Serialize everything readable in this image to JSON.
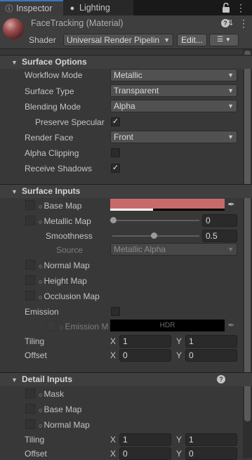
{
  "tabs": {
    "inspector": "Inspector",
    "lighting": "Lighting",
    "inspector_icon": "info-icon",
    "lighting_icon": "lightbulb-icon"
  },
  "material": {
    "name": "FaceTracking (Material)",
    "shader_label": "Shader",
    "shader_value": "Universal Render Pipelin",
    "edit_button": "Edit...",
    "list_icon": "list-icon"
  },
  "surface_options": {
    "title": "Surface Options",
    "workflow_mode": {
      "label": "Workflow Mode",
      "value": "Metallic"
    },
    "surface_type": {
      "label": "Surface Type",
      "value": "Transparent"
    },
    "blending_mode": {
      "label": "Blending Mode",
      "value": "Alpha"
    },
    "preserve_specular": {
      "label": "Preserve Specular",
      "checked": true
    },
    "render_face": {
      "label": "Render Face",
      "value": "Front"
    },
    "alpha_clipping": {
      "label": "Alpha Clipping",
      "checked": false
    },
    "receive_shadows": {
      "label": "Receive Shadows",
      "checked": true
    }
  },
  "surface_inputs": {
    "title": "Surface Inputs",
    "base_map": {
      "label": "Base Map",
      "color": "#c96a6a"
    },
    "metallic_map": {
      "label": "Metallic Map",
      "value": "0",
      "slider": 0
    },
    "smoothness": {
      "label": "Smoothness",
      "value": "0.5",
      "slider": 0.5
    },
    "source": {
      "label": "Source",
      "value": "Metallic Alpha"
    },
    "normal_map": {
      "label": "Normal Map"
    },
    "height_map": {
      "label": "Height Map"
    },
    "occlusion_map": {
      "label": "Occlusion Map"
    },
    "emission": {
      "label": "Emission",
      "checked": false
    },
    "emission_map": {
      "label": "Emission M",
      "hdr": "HDR"
    },
    "tiling": {
      "label": "Tiling",
      "x_axis": "X",
      "x": "1",
      "y_axis": "Y",
      "y": "1"
    },
    "offset": {
      "label": "Offset",
      "x_axis": "X",
      "x": "0",
      "y_axis": "Y",
      "y": "0"
    }
  },
  "detail_inputs": {
    "title": "Detail Inputs",
    "help_icon": "help-icon",
    "mask": {
      "label": "Mask"
    },
    "base_map": {
      "label": "Base Map"
    },
    "normal_map": {
      "label": "Normal Map"
    },
    "tiling": {
      "label": "Tiling",
      "x_axis": "X",
      "x": "1",
      "y_axis": "Y",
      "y": "1"
    },
    "offset": {
      "label": "Offset",
      "x_axis": "X",
      "x": "0",
      "y_axis": "Y",
      "y": "0"
    }
  }
}
